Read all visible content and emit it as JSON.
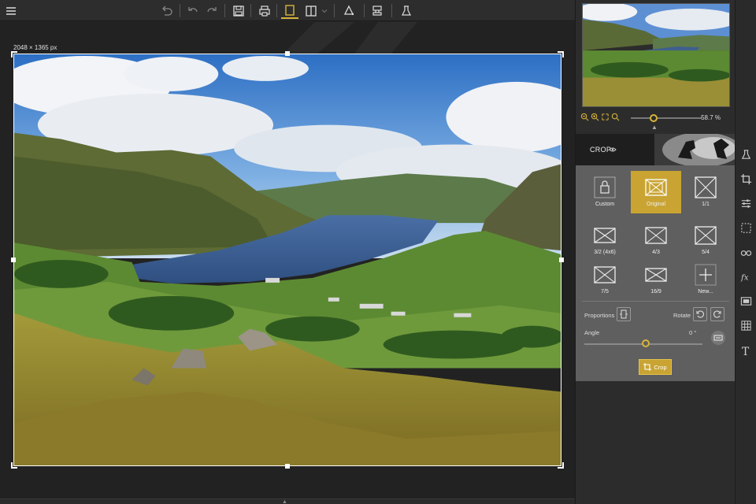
{
  "toolbar": {
    "icons": [
      "menu-icon",
      "undo-all-icon",
      "undo-icon",
      "redo-icon",
      "save-icon",
      "print-icon",
      "single-view-icon",
      "compare-view-icon",
      "shape-icon",
      "stamp-icon",
      "lab-icon"
    ]
  },
  "canvas": {
    "image_size": "2048 × 1365 px"
  },
  "panel": {
    "zoom_value": "58.7 %",
    "crop_title": "CROP",
    "ratios": [
      {
        "label": "Custom"
      },
      {
        "label": "Original"
      },
      {
        "label": "1/1"
      },
      {
        "label": "3/2 (4x6)"
      },
      {
        "label": "4/3"
      },
      {
        "label": "5/4"
      },
      {
        "label": "7/5"
      },
      {
        "label": "16/9"
      },
      {
        "label": "New..."
      }
    ],
    "selected_ratio": "Original",
    "proportions_label": "Proportions",
    "rotate_label": "Rotate",
    "angle_label": "Angle",
    "angle_value": "0 °",
    "crop_button": "Crop"
  },
  "strip": {
    "icons": [
      "lab-icon",
      "crop-icon",
      "adjust-icon",
      "selection-icon",
      "glasses-icon",
      "fx-icon",
      "frame-icon",
      "texture-icon",
      "text-icon"
    ]
  },
  "colors": {
    "accent": "#c9a433",
    "background": "#262626"
  }
}
